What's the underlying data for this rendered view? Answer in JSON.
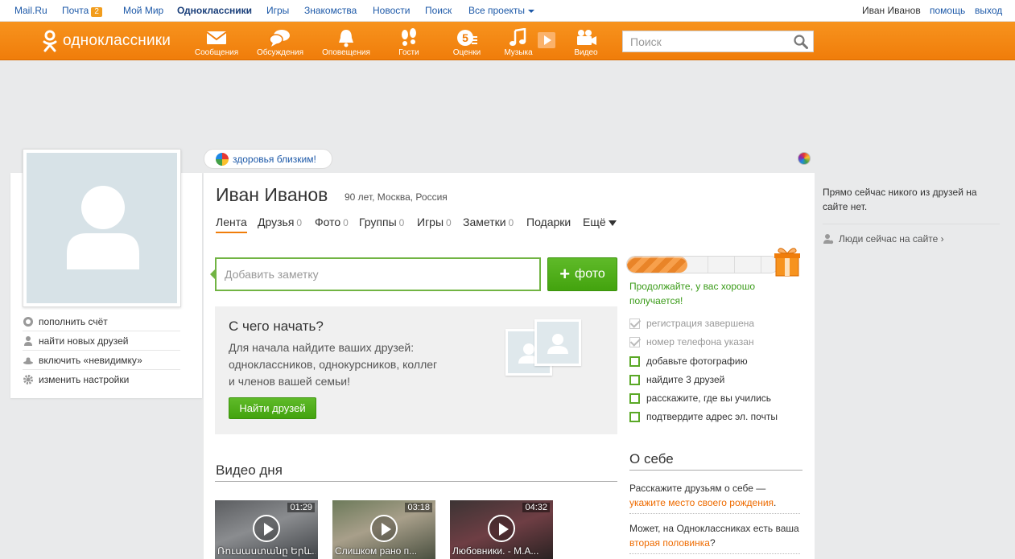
{
  "mailbar": {
    "links": [
      "Mail.Ru",
      "Почта",
      "Мой Мир",
      "Одноклассники",
      "Игры",
      "Знакомства",
      "Новости",
      "Поиск",
      "Все проекты"
    ],
    "mail_badge": "2",
    "user_name": "Иван Иванов",
    "help": "помощь",
    "logout": "выход"
  },
  "header": {
    "logo_text": "одноклассники",
    "nav": [
      "Сообщения",
      "Обсуждения",
      "Оповещения",
      "Гости",
      "Оценки",
      "Музыка",
      "Видео"
    ],
    "search_placeholder": "Поиск",
    "brand_color": "#f7931e"
  },
  "left_menu": [
    "пополнить счёт",
    "найти новых друзей",
    "включить «невидимку»",
    "изменить настройки"
  ],
  "promo": "здоровья близким!",
  "profile": {
    "name": "Иван Иванов",
    "info": "90 лет, Москва, Россия"
  },
  "tabs": [
    {
      "label": "Лента",
      "count": ""
    },
    {
      "label": "Друзья",
      "count": "0"
    },
    {
      "label": "Фото",
      "count": "0"
    },
    {
      "label": "Группы",
      "count": "0"
    },
    {
      "label": "Игры",
      "count": "0"
    },
    {
      "label": "Заметки",
      "count": "0"
    },
    {
      "label": "Подарки",
      "count": ""
    },
    {
      "label": "Ещё",
      "count": ""
    }
  ],
  "note_placeholder": "Добавить заметку",
  "photo_button": "фото",
  "start": {
    "title": "С чего начать?",
    "description": "Для начала найдите ваших друзей: одноклассников, однокурсников, коллег и членов вашей семьи!",
    "button": "Найти друзей"
  },
  "videos": {
    "title": "Видео дня",
    "items": [
      {
        "duration": "01:29",
        "title": "Ռուսաստանը Երև..."
      },
      {
        "duration": "03:18",
        "title": "Слишком рано п..."
      },
      {
        "duration": "04:32",
        "title": "Любовники. - М.А..."
      }
    ]
  },
  "progress": {
    "fraction": 0.4,
    "message": "Продолжайте, у вас хорошо получается!",
    "steps": [
      {
        "label": "регистрация завершена",
        "done": true
      },
      {
        "label": "номер телефона указан",
        "done": true
      },
      {
        "label": "добавьте фотографию",
        "done": false
      },
      {
        "label": "найдите 3 друзей",
        "done": false
      },
      {
        "label": "расскажите, где вы учились",
        "done": false
      },
      {
        "label": "подтвердите адрес эл. почты",
        "done": false
      }
    ]
  },
  "about": {
    "title": "О себе",
    "p1_text": "Расскажите друзьям о себе —",
    "p1_link": "укажите место своего рождения",
    "p2_text": "Может, на Одноклассниках есть ваша",
    "p2_link": "вторая половинка",
    "p2_end": "?"
  },
  "right": {
    "online_msg": "Прямо сейчас никого из друзей на сайте нет.",
    "online_link": "Люди сейчас на сайте ›"
  }
}
